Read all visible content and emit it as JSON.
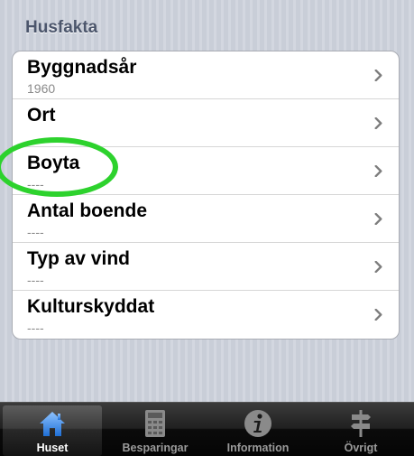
{
  "section": {
    "title": "Husfakta"
  },
  "rows": [
    {
      "title": "Byggnadsår",
      "value": "1960"
    },
    {
      "title": "Ort",
      "value": ""
    },
    {
      "title": "Boyta",
      "value": "----"
    },
    {
      "title": "Antal boende",
      "value": "----"
    },
    {
      "title": "Typ av vind",
      "value": "----"
    },
    {
      "title": "Kulturskyddat",
      "value": "----"
    }
  ],
  "tabs": [
    {
      "label": "Huset",
      "icon": "house-icon",
      "selected": true
    },
    {
      "label": "Besparingar",
      "icon": "calculator-icon",
      "selected": false
    },
    {
      "label": "Information",
      "icon": "info-icon",
      "selected": false
    },
    {
      "label": "Övrigt",
      "icon": "signpost-icon",
      "selected": false
    }
  ],
  "colors": {
    "highlight": "#2dd22d",
    "accent": "#4a8fe0"
  }
}
